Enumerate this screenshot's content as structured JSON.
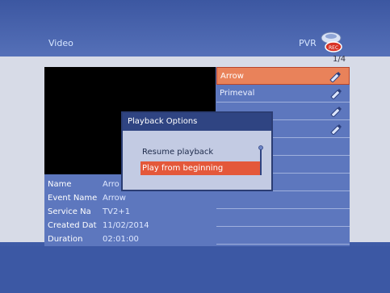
{
  "header": {
    "title": "Video",
    "pvr_label": "PVR",
    "page_count": "1/4"
  },
  "recordings": [
    {
      "name": "Arrow",
      "selected": true
    },
    {
      "name": "Primeval",
      "selected": false
    },
    {
      "name": "",
      "selected": false
    },
    {
      "name": "",
      "selected": false
    },
    {
      "name": "",
      "selected": false
    },
    {
      "name": "",
      "selected": false
    },
    {
      "name": "",
      "selected": false
    },
    {
      "name": "",
      "selected": false
    },
    {
      "name": "",
      "selected": false
    },
    {
      "name": "",
      "selected": false
    }
  ],
  "info": {
    "name_label": "Name",
    "name_value": "Arro",
    "event_label": "Event Name",
    "event_value": "Arrow",
    "service_label": "Service Na",
    "service_value": "TV2+1",
    "created_label": "Created Dat",
    "created_value": "11/02/2014",
    "duration_label": "Duration",
    "duration_value": "02:01:00"
  },
  "dialog": {
    "title": "Playback Options",
    "options": [
      "Resume playback",
      "Play from beginning"
    ]
  },
  "colors": {
    "selected_row": "#e9825a",
    "highlight": "#e4583a",
    "panel": "#5d77be"
  },
  "icons": [
    "pvr-record-icon",
    "edit-pencil-icon"
  ]
}
